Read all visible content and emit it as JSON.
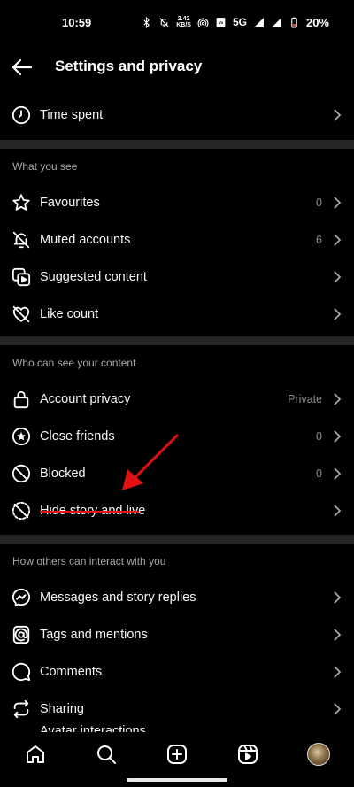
{
  "status": {
    "time": "10:59",
    "speed_value": "2.42",
    "speed_unit": "KB/S",
    "network": "5G",
    "battery": "20%"
  },
  "header": {
    "title": "Settings and privacy"
  },
  "top_item": {
    "label": "Time spent"
  },
  "sections": [
    {
      "title": "What you see",
      "items": [
        {
          "label": "Favourites",
          "value": "0"
        },
        {
          "label": "Muted accounts",
          "value": "6"
        },
        {
          "label": "Suggested content",
          "value": ""
        },
        {
          "label": "Like count",
          "value": ""
        }
      ]
    },
    {
      "title": "Who can see your content",
      "items": [
        {
          "label": "Account privacy",
          "value": "Private"
        },
        {
          "label": "Close friends",
          "value": "0"
        },
        {
          "label": "Blocked",
          "value": "0"
        },
        {
          "label": "Hide story and live",
          "value": ""
        }
      ]
    },
    {
      "title": "How others can interact with you",
      "items": [
        {
          "label": "Messages and story replies",
          "value": ""
        },
        {
          "label": "Tags and mentions",
          "value": ""
        },
        {
          "label": "Comments",
          "value": ""
        },
        {
          "label": "Sharing",
          "value": ""
        },
        {
          "label": "Avatar interactions",
          "value": ""
        }
      ]
    }
  ],
  "annotation": {
    "color": "#e11111"
  }
}
